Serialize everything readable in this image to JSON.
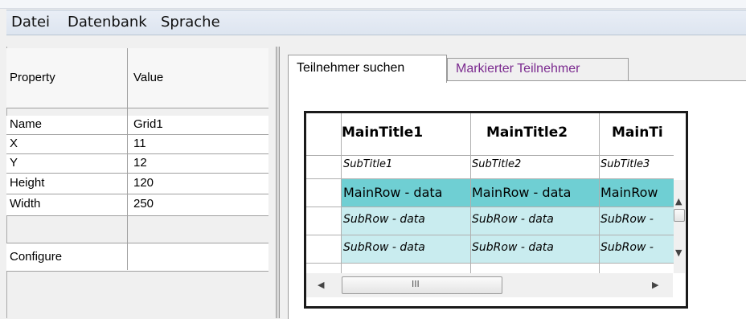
{
  "menu": {
    "items": [
      "Datei",
      "Datenbank",
      "Sprache"
    ]
  },
  "properties": {
    "header": {
      "property": "Property",
      "value": "Value"
    },
    "rows": [
      {
        "property": "Name",
        "value": "Grid1"
      },
      {
        "property": "X",
        "value": "11"
      },
      {
        "property": "Y",
        "value": "12"
      },
      {
        "property": "Height",
        "value": "120"
      },
      {
        "property": "Width",
        "value": "250"
      },
      {
        "property": "Configure",
        "value": ""
      }
    ]
  },
  "tabs": [
    {
      "label": "Teilnehmer suchen",
      "active": true
    },
    {
      "label": "Markierter Teilnehmer",
      "active": false
    }
  ],
  "grid": {
    "main_titles": [
      "MainTitle1",
      "MainTitle2",
      "MainTi"
    ],
    "sub_titles": [
      "SubTitle1",
      "SubTitle2",
      "SubTitle3"
    ],
    "main_row": [
      "MainRow - data",
      "MainRow - data",
      "MainRow"
    ],
    "sub_rows": [
      [
        "SubRow - data",
        "SubRow - data",
        "SubRow -"
      ],
      [
        "SubRow - data",
        "SubRow - data",
        "SubRow -"
      ]
    ],
    "colors": {
      "main_row_bg": "#6fcfd3",
      "sub_row_bg": "#c9ecef",
      "border": "#1a1a1a"
    }
  },
  "scrollbars": {
    "h_thumb_icon": "grip-icon",
    "left_arrow": "◀",
    "right_arrow": "▶",
    "up_arrow": "▲",
    "down_arrow": "▼",
    "grip": "III"
  }
}
